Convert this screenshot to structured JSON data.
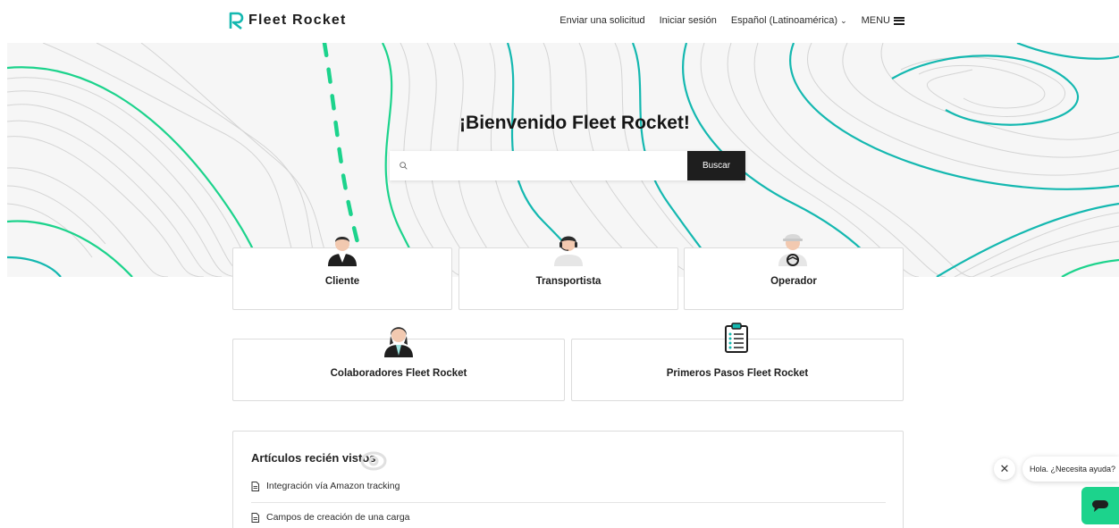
{
  "header": {
    "logo_text": "Fleet Rocket",
    "nav": {
      "submit_request": "Enviar una solicitud",
      "sign_in": "Iniciar sesión",
      "language": "Español (Latinoamérica)",
      "menu": "MENU"
    }
  },
  "hero": {
    "title": "¡Bienvenido Fleet Rocket!",
    "search": {
      "placeholder": "",
      "button_label": "Buscar"
    }
  },
  "categories": [
    {
      "label": "Cliente",
      "icon": "client-avatar-icon"
    },
    {
      "label": "Transportista",
      "icon": "carrier-avatar-icon"
    },
    {
      "label": "Operador",
      "icon": "operator-avatar-icon"
    },
    {
      "label": "Colaboradores Fleet Rocket",
      "icon": "collaborator-avatar-icon"
    },
    {
      "label": "Primeros Pasos Fleet Rocket",
      "icon": "clipboard-icon"
    }
  ],
  "recent": {
    "title": "Artículos recién vistos",
    "articles": [
      "Integración vía Amazon tracking",
      "Campos de creación de una carga"
    ]
  },
  "chat": {
    "bubble_text": "Hola. ¿Necesita ayuda?"
  },
  "colors": {
    "brand_teal": "#14b8b0",
    "brand_green": "#1cd38c",
    "dark_button": "#1e1e1e"
  }
}
